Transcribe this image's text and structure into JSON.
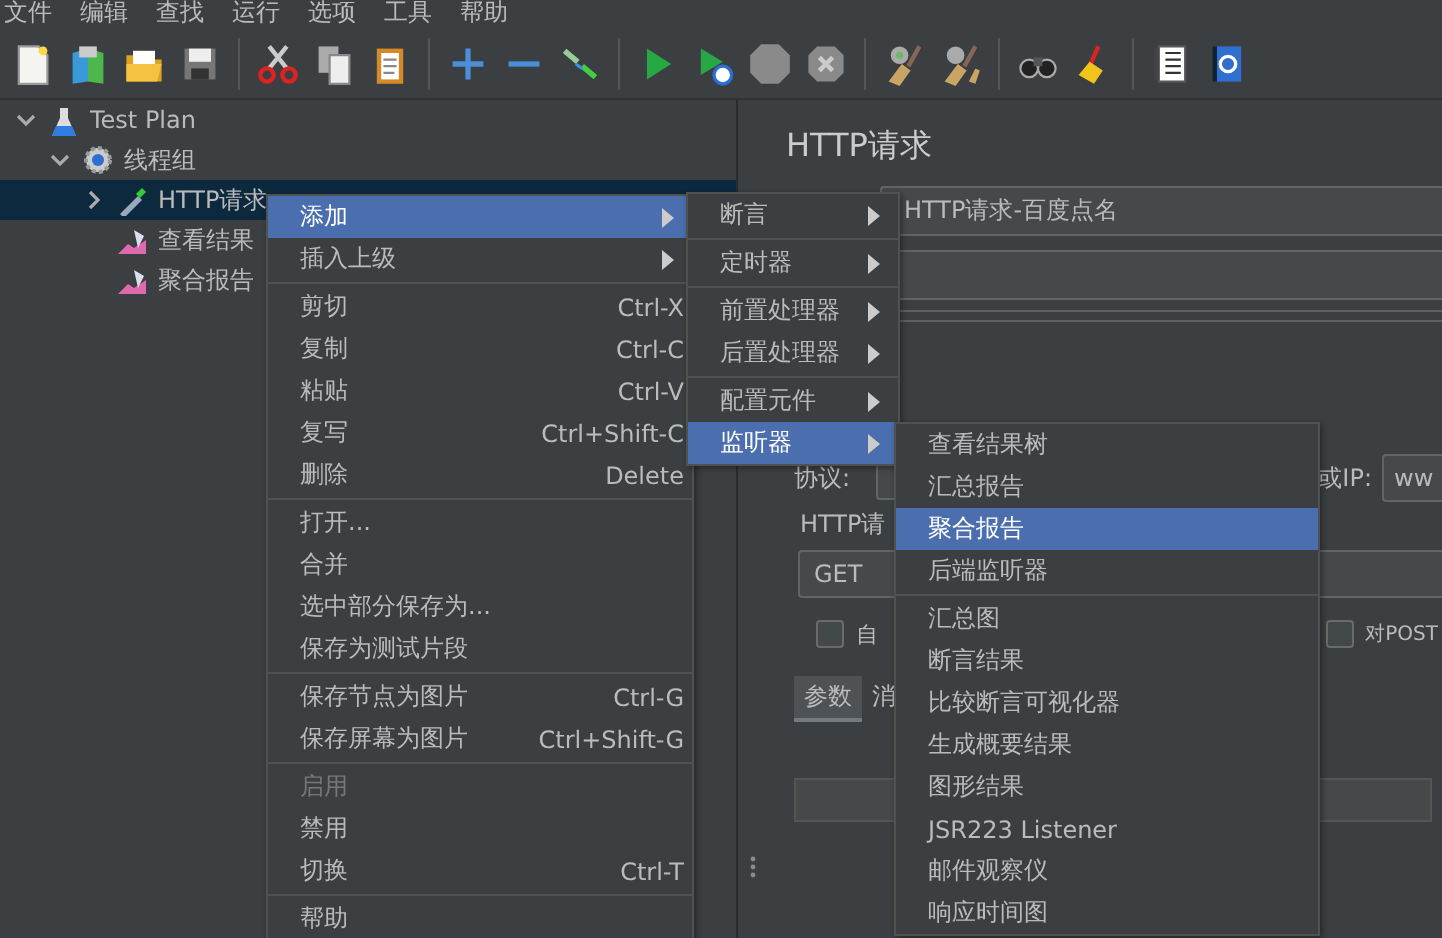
{
  "menu_bar": [
    "文件",
    "编辑",
    "查找",
    "运行",
    "选项",
    "工具",
    "帮助"
  ],
  "tree": [
    {
      "label": "Test Plan",
      "kind": "plan",
      "selected": false,
      "expanded": true,
      "children": [
        {
          "label": "线程组",
          "kind": "thread_group",
          "selected": false,
          "expanded": true,
          "children": [
            {
              "label": "HTTP请求",
              "kind": "sampler",
              "selected": true,
              "expanded": false
            },
            {
              "label": "查看结果",
              "kind": "listener",
              "selected": false
            },
            {
              "label": "聚合报告",
              "kind": "listener",
              "selected": false
            }
          ]
        }
      ]
    }
  ],
  "editor": {
    "title": "HTTP请求",
    "name_value": "HTTP请求-百度点名",
    "protocol_label": "协议:",
    "server_label": "或IP:",
    "server_value": "ww",
    "request_label": "HTTP请",
    "method": "GET",
    "checkboxes": [
      {
        "label": "自",
        "checked": false
      },
      {
        "label": "对POST",
        "checked": false
      }
    ],
    "tabs": [
      {
        "label": "参数",
        "selected": true
      },
      {
        "label": "消",
        "selected": false
      }
    ]
  },
  "context_menu": {
    "items": [
      {
        "kind": "item",
        "label": "添加",
        "submenu": true,
        "selected": true,
        "disabled": false
      },
      {
        "kind": "item",
        "label": "插入上级",
        "submenu": true,
        "selected": false,
        "disabled": false
      },
      {
        "kind": "separator"
      },
      {
        "kind": "item",
        "label": "剪切",
        "shortcut": "Ctrl-X",
        "submenu": false,
        "selected": false,
        "disabled": false
      },
      {
        "kind": "item",
        "label": "复制",
        "shortcut": "Ctrl-C",
        "submenu": false,
        "selected": false,
        "disabled": false
      },
      {
        "kind": "item",
        "label": "粘贴",
        "shortcut": "Ctrl-V",
        "submenu": false,
        "selected": false,
        "disabled": false
      },
      {
        "kind": "item",
        "label": "复写",
        "shortcut": "Ctrl+Shift-C",
        "submenu": false,
        "selected": false,
        "disabled": false
      },
      {
        "kind": "item",
        "label": "删除",
        "shortcut": "Delete",
        "submenu": false,
        "selected": false,
        "disabled": false
      },
      {
        "kind": "separator"
      },
      {
        "kind": "item",
        "label": "打开...",
        "submenu": false,
        "selected": false,
        "disabled": false
      },
      {
        "kind": "item",
        "label": "合并",
        "submenu": false,
        "selected": false,
        "disabled": false
      },
      {
        "kind": "item",
        "label": "选中部分保存为...",
        "submenu": false,
        "selected": false,
        "disabled": false
      },
      {
        "kind": "item",
        "label": "保存为测试片段",
        "submenu": false,
        "selected": false,
        "disabled": false
      },
      {
        "kind": "separator"
      },
      {
        "kind": "item",
        "label": "保存节点为图片",
        "shortcut": "Ctrl-G",
        "submenu": false,
        "selected": false,
        "disabled": false
      },
      {
        "kind": "item",
        "label": "保存屏幕为图片",
        "shortcut": "Ctrl+Shift-G",
        "submenu": false,
        "selected": false,
        "disabled": false
      },
      {
        "kind": "separator"
      },
      {
        "kind": "item",
        "label": "启用",
        "submenu": false,
        "selected": false,
        "disabled": true
      },
      {
        "kind": "item",
        "label": "禁用",
        "submenu": false,
        "selected": false,
        "disabled": false
      },
      {
        "kind": "item",
        "label": "切换",
        "shortcut": "Ctrl-T",
        "submenu": false,
        "selected": false,
        "disabled": false
      },
      {
        "kind": "separator"
      },
      {
        "kind": "item",
        "label": "帮助",
        "submenu": false,
        "selected": false,
        "disabled": false
      }
    ]
  },
  "add_submenu": {
    "items": [
      {
        "kind": "item",
        "label": "断言",
        "submenu": true,
        "selected": false
      },
      {
        "kind": "separator"
      },
      {
        "kind": "item",
        "label": "定时器",
        "submenu": true,
        "selected": false
      },
      {
        "kind": "separator"
      },
      {
        "kind": "item",
        "label": "前置处理器",
        "submenu": true,
        "selected": false
      },
      {
        "kind": "item",
        "label": "后置处理器",
        "submenu": true,
        "selected": false
      },
      {
        "kind": "separator"
      },
      {
        "kind": "item",
        "label": "配置元件",
        "submenu": true,
        "selected": false
      },
      {
        "kind": "item",
        "label": "监听器",
        "submenu": true,
        "selected": true
      }
    ]
  },
  "listener_submenu": {
    "items": [
      {
        "kind": "item",
        "label": "查看结果树",
        "selected": false
      },
      {
        "kind": "item",
        "label": "汇总报告",
        "selected": false
      },
      {
        "kind": "item",
        "label": "聚合报告",
        "selected": true
      },
      {
        "kind": "item",
        "label": "后端监听器",
        "selected": false
      },
      {
        "kind": "separator"
      },
      {
        "kind": "item",
        "label": "汇总图",
        "selected": false
      },
      {
        "kind": "item",
        "label": "断言结果",
        "selected": false
      },
      {
        "kind": "item",
        "label": "比较断言可视化器",
        "selected": false
      },
      {
        "kind": "item",
        "label": "生成概要结果",
        "selected": false
      },
      {
        "kind": "item",
        "label": "图形结果",
        "selected": false
      },
      {
        "kind": "item",
        "label": "JSR223 Listener",
        "selected": false
      },
      {
        "kind": "item",
        "label": "邮件观察仪",
        "selected": false
      },
      {
        "kind": "item",
        "label": "响应时间图",
        "selected": false
      }
    ]
  }
}
